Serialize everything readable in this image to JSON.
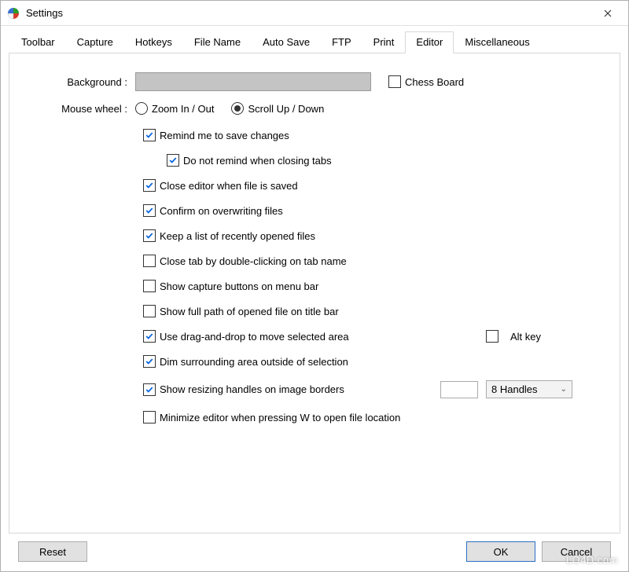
{
  "window": {
    "title": "Settings"
  },
  "tabs": [
    "Toolbar",
    "Capture",
    "Hotkeys",
    "File Name",
    "Auto Save",
    "FTP",
    "Print",
    "Editor",
    "Miscellaneous"
  ],
  "active_tab_index": 7,
  "editor": {
    "background_label": "Background :",
    "background_color": "#c4c4c4",
    "chess_board_label": "Chess Board",
    "chess_board_checked": false,
    "mouse_wheel_label": "Mouse wheel :",
    "mouse_wheel_options": {
      "zoom": "Zoom In / Out",
      "scroll": "Scroll Up / Down",
      "selected": "scroll"
    },
    "options": [
      {
        "key": "remind_save",
        "label": "Remind me to save changes",
        "checked": true
      },
      {
        "key": "no_remind_tabs",
        "label": "Do not remind when closing tabs",
        "checked": true,
        "indent": true
      },
      {
        "key": "close_on_save",
        "label": "Close editor when file is saved",
        "checked": true
      },
      {
        "key": "confirm_overwrite",
        "label": "Confirm on overwriting files",
        "checked": true
      },
      {
        "key": "recent_list",
        "label": "Keep a list of recently opened files",
        "checked": true
      },
      {
        "key": "close_tab_dbl",
        "label": "Close tab by double-clicking on tab name",
        "checked": false
      },
      {
        "key": "capture_buttons_menubar",
        "label": "Show capture buttons on menu bar",
        "checked": false
      },
      {
        "key": "full_path_title",
        "label": "Show full path of opened file on title bar",
        "checked": false
      },
      {
        "key": "drag_drop_move",
        "label": "Use drag-and-drop to move selected area",
        "checked": true,
        "alt_key": false,
        "alt_key_label": "Alt key"
      },
      {
        "key": "dim_surrounding",
        "label": "Dim surrounding area outside of selection",
        "checked": true
      },
      {
        "key": "resize_handles",
        "label": "Show resizing handles on image borders",
        "checked": true,
        "num": "",
        "combo": "8 Handles"
      },
      {
        "key": "minimize_w",
        "label": "Minimize editor when pressing W to open file location",
        "checked": false
      }
    ]
  },
  "buttons": {
    "reset": "Reset",
    "ok": "OK",
    "cancel": "Cancel"
  },
  "watermark": "LO4D.com"
}
